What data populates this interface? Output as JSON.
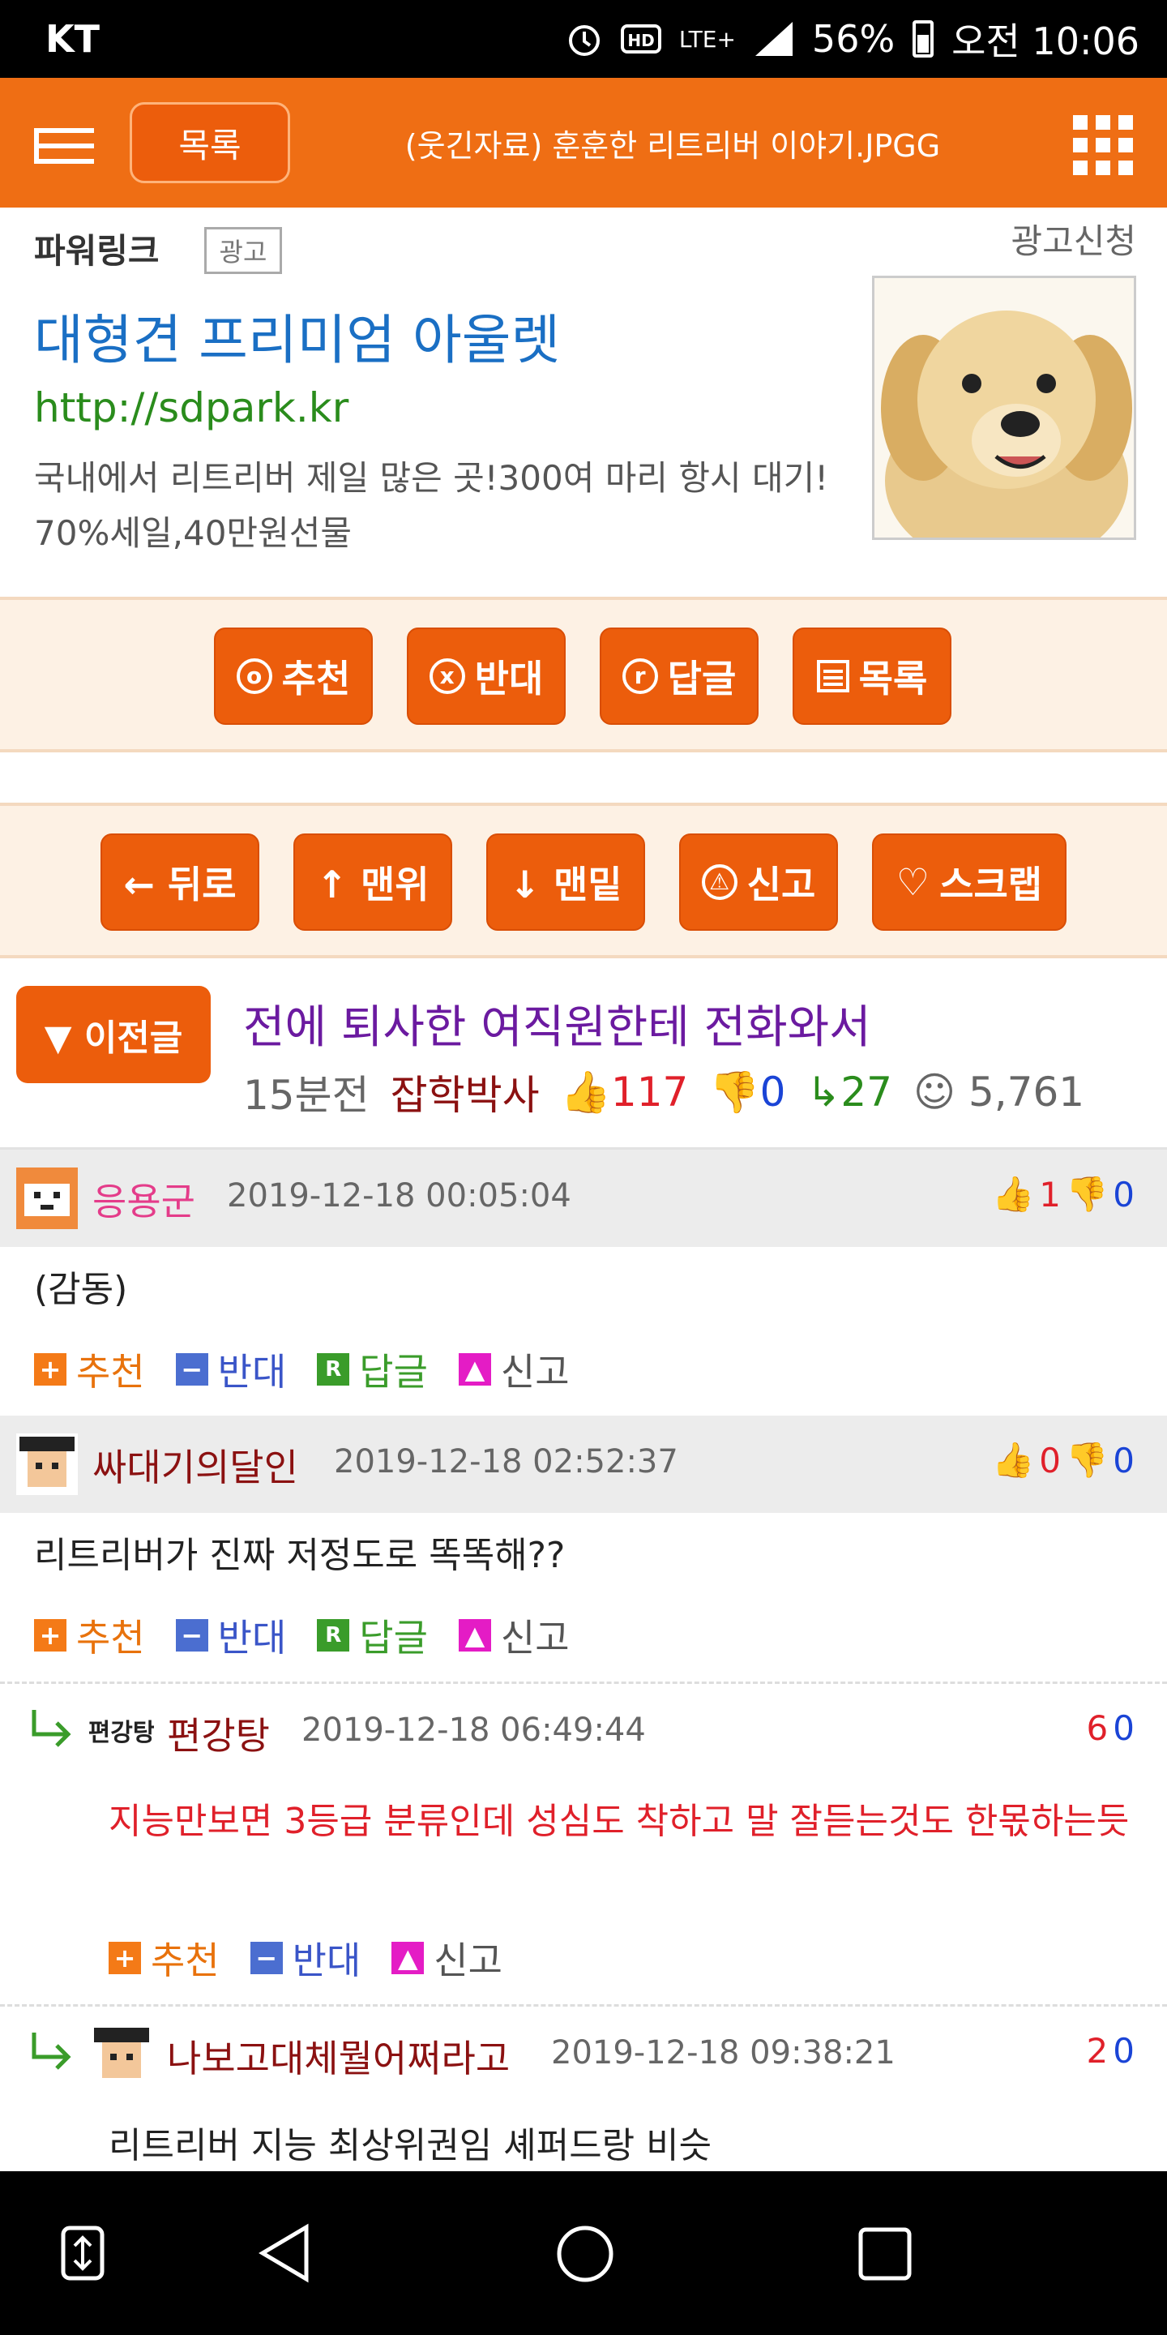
{
  "status_bar": {
    "carrier": "KT",
    "network": "LTE+",
    "battery": "56%",
    "time": "오전 10:06"
  },
  "header": {
    "list_button": "목록",
    "title": "(웃긴자료) 훈훈한 리트리버 이야기.JPGG"
  },
  "ad": {
    "label": "파워링크",
    "badge": "광고",
    "apply": "광고신청",
    "headline": "대형견 프리미엄 아울렛",
    "url": "http://sdpark.kr",
    "description": "국내에서 리트리버 제일 많은 곳!300여 마리 항시 대기! 70%세일,40만원선물"
  },
  "actions1": {
    "recommend": "추천",
    "oppose": "반대",
    "reply": "답글",
    "list": "목록"
  },
  "actions2": {
    "back": "← 뒤로",
    "top": "↑ 맨위",
    "bottom": "↓ 맨밑",
    "report": "신고",
    "scrap": "스크랩"
  },
  "prev_post": {
    "button": "▼ 이전글",
    "title": "전에 퇴사한 여직원한테 전화와서",
    "time": "15분전",
    "author": "잡학박사",
    "likes": "117",
    "dislikes": "0",
    "replies": "27",
    "views": "5,761"
  },
  "comment_actions": {
    "recommend": "추천",
    "oppose": "반대",
    "reply": "답글",
    "report": "신고"
  },
  "comments": [
    {
      "name": "응용군",
      "date": "2019-12-18 00:05:04",
      "up": "1",
      "down": "0",
      "body": "(감동)"
    },
    {
      "name": "싸대기의달인",
      "date": "2019-12-18 02:52:37",
      "up": "0",
      "down": "0",
      "body": "리트리버가 진짜 저정도로 똑똑해??"
    },
    {
      "name": "편강탕",
      "date": "2019-12-18 06:49:44",
      "up": "6",
      "down": "0",
      "body": "지능만보면 3등급 분류인데 성심도 착하고 말 잘듣는것도 한몫하는듯"
    },
    {
      "name": "나보고대체뭘어쩌라고",
      "date": "2019-12-18 09:38:21",
      "up": "2",
      "down": "0",
      "body": "리트리버 지능 최상위권임 셰퍼드랑 비슷"
    }
  ],
  "colors": {
    "brand": "#ef6e14",
    "button": "#ec5d0c",
    "ad_headline": "#1a6fc4",
    "ad_url": "#2a8c1c"
  }
}
